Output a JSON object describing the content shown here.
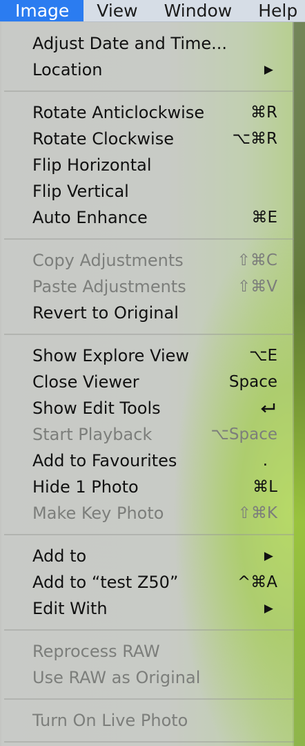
{
  "menubar": {
    "items": [
      "Image",
      "View",
      "Window",
      "Help"
    ],
    "active_index": 0
  },
  "menu": {
    "groups": [
      [
        {
          "label": "Adjust Date and Time...",
          "enabled": true
        },
        {
          "label": "Location",
          "submenu": true,
          "enabled": true
        }
      ],
      [
        {
          "label": "Rotate Anticlockwise",
          "shortcut": "⌘R",
          "enabled": true
        },
        {
          "label": "Rotate Clockwise",
          "shortcut": "⌥⌘R",
          "enabled": true
        },
        {
          "label": "Flip Horizontal",
          "enabled": true
        },
        {
          "label": "Flip Vertical",
          "enabled": true
        },
        {
          "label": "Auto Enhance",
          "shortcut": "⌘E",
          "enabled": true
        }
      ],
      [
        {
          "label": "Copy Adjustments",
          "shortcut": "⇧⌘C",
          "enabled": false
        },
        {
          "label": "Paste Adjustments",
          "shortcut": "⇧⌘V",
          "enabled": false
        },
        {
          "label": "Revert to Original",
          "enabled": true
        }
      ],
      [
        {
          "label": "Show Explore View",
          "shortcut": "⌥E",
          "enabled": true
        },
        {
          "label": "Close Viewer",
          "shortcut": "Space",
          "enabled": true
        },
        {
          "label": "Show Edit Tools",
          "shortcut_icon": "return-key-icon",
          "enabled": true
        },
        {
          "label": "Start Playback",
          "shortcut": "⌥Space",
          "enabled": false
        },
        {
          "label": "Add to Favourites",
          "shortcut": ".",
          "enabled": true
        },
        {
          "label": "Hide 1 Photo",
          "shortcut": "⌘L",
          "enabled": true
        },
        {
          "label": "Make Key Photo",
          "shortcut": "⇧⌘K",
          "enabled": false
        }
      ],
      [
        {
          "label": "Add to",
          "submenu": true,
          "enabled": true
        },
        {
          "label": "Add to “test Z50”",
          "shortcut": "^⌘A",
          "enabled": true
        },
        {
          "label": "Edit With",
          "submenu": true,
          "enabled": true
        }
      ],
      [
        {
          "label": "Reprocess RAW",
          "enabled": false
        },
        {
          "label": "Use RAW as Original",
          "enabled": false
        }
      ],
      [
        {
          "label": "Turn On Live Photo",
          "enabled": false
        }
      ]
    ]
  }
}
